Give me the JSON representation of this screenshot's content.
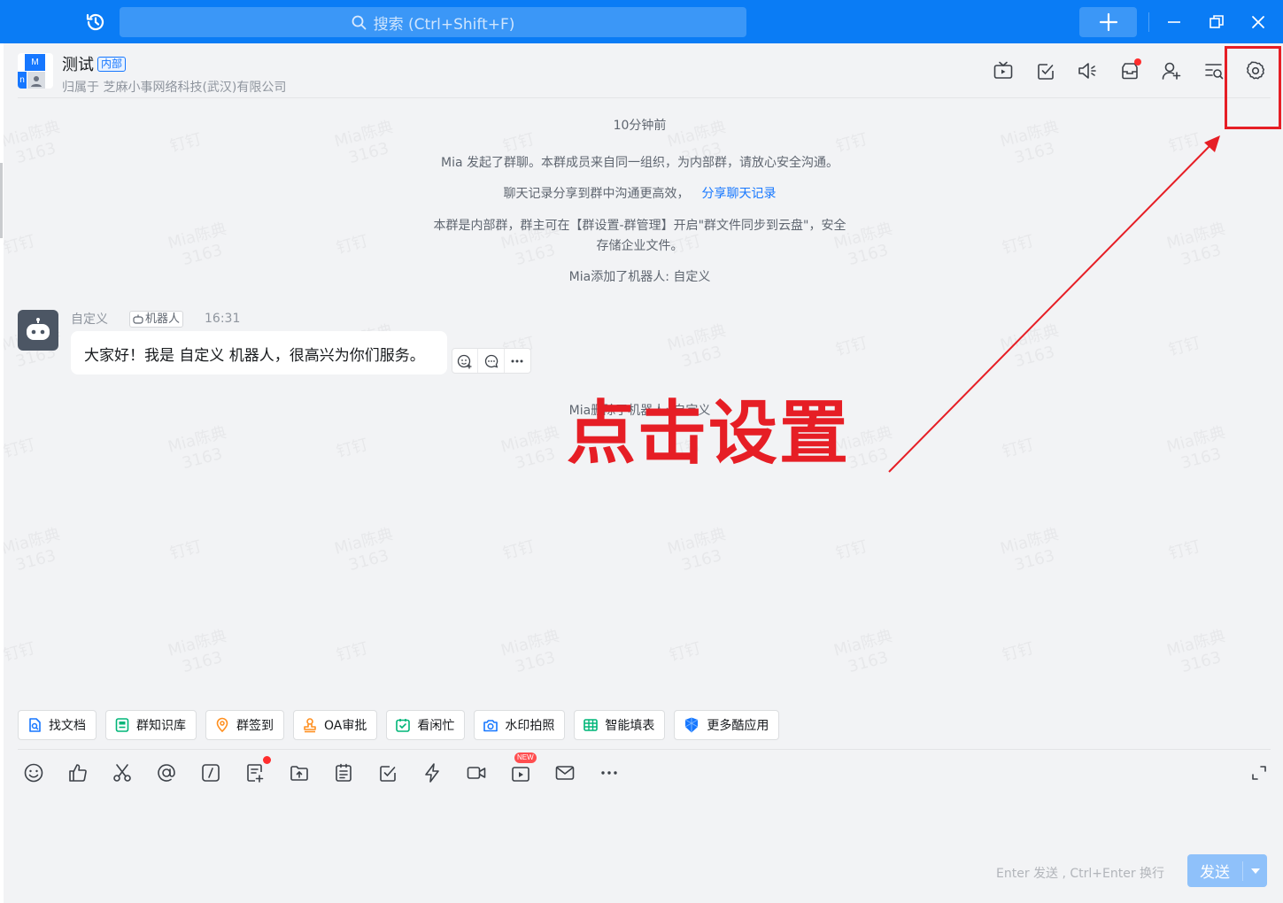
{
  "titlebar": {
    "search_placeholder": "搜索 (Ctrl+Shift+F)",
    "accent": "#0a7cf5"
  },
  "header": {
    "title": "测试",
    "badge": "内部",
    "subtitle": "归属于 芝麻小事网络科技(武汉)有限公司",
    "avatar_letters": [
      "M",
      "n"
    ],
    "icons": [
      "tv-icon",
      "task-check-icon",
      "announcement-icon",
      "inbox-icon",
      "add-member-icon",
      "search-history-icon",
      "settings-gear-icon"
    ]
  },
  "chat": {
    "timestamp": "10分钟前",
    "system_messages": [
      "Mia 发起了群聊。本群成员来自同一组织，为内部群，请放心安全沟通。",
      "聊天记录分享到群中沟通更高效，"
    ],
    "share_link": "分享聊天记录",
    "notice_line1": "本群是内部群，群主可在【群设置-群管理】开启\"群文件同步到云盘\"，安全",
    "notice_line2": "存储企业文件。",
    "robot_added": "Mia添加了机器人: 自定义",
    "robot_removed": "Mia删除了机器人: 自定义",
    "message": {
      "sender": "自定义",
      "tag": "机器人",
      "time": "16:31",
      "text": "大家好！我是 自定义 机器人，很高兴为你们服务。"
    },
    "watermark": {
      "name": "Mia陈典",
      "id": "3163",
      "brand": "钉钉"
    }
  },
  "annotation": {
    "text": "点击设置",
    "color": "#e61e25"
  },
  "quick_apps": [
    {
      "label": "找文档",
      "icon": "find-doc-icon"
    },
    {
      "label": "群知识库",
      "icon": "knowledge-base-icon"
    },
    {
      "label": "群签到",
      "icon": "check-in-icon"
    },
    {
      "label": "OA审批",
      "icon": "oa-approval-icon"
    },
    {
      "label": "看闲忙",
      "icon": "calendar-check-icon"
    },
    {
      "label": "水印拍照",
      "icon": "camera-icon"
    },
    {
      "label": "智能填表",
      "icon": "table-icon"
    },
    {
      "label": "更多酷应用",
      "icon": "cool-apps-icon"
    }
  ],
  "toolbar": {
    "new_badge": "NEW",
    "icons": [
      "emoji-icon",
      "thumbs-up-icon",
      "scissors-icon",
      "mention-icon",
      "slash-command-icon",
      "doc-add-icon",
      "file-upload-icon",
      "schedule-icon",
      "todo-check-icon",
      "lightning-icon",
      "video-call-icon",
      "live-icon",
      "mail-icon",
      "more-icon",
      "expand-icon"
    ]
  },
  "composer": {
    "hint": "Enter 发送 , Ctrl+Enter 换行",
    "send_label": "发送"
  }
}
